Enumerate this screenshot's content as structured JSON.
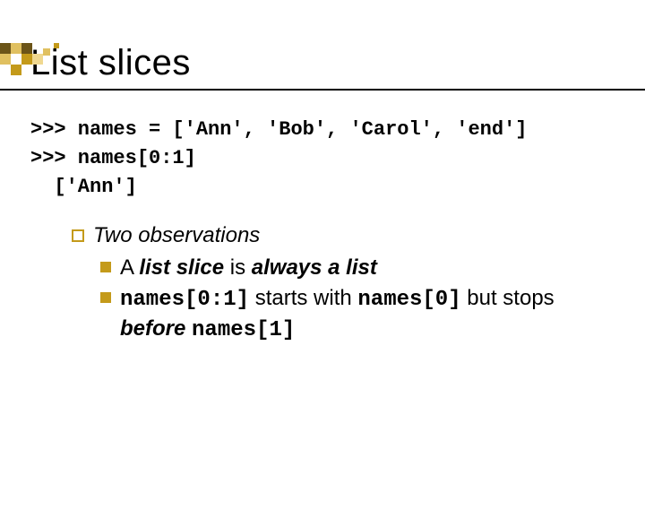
{
  "title": "List slices",
  "code": {
    "line1": ">>> names = ['Ann', 'Bob', 'Carol', 'end']",
    "line2": ">>> names[0:1]",
    "line3": "  ['Ann']"
  },
  "observations": {
    "header": "Two observations",
    "item1": {
      "pre": "A ",
      "bold1": "list slice",
      "mid": " is ",
      "bold2": "always a list"
    },
    "item2": {
      "code1": "names[0:1]",
      "t1": " starts with ",
      "code2": "names[0]",
      "t2": " but stops ",
      "bold1": "before",
      "t3": " ",
      "code3": "names[1]"
    }
  }
}
